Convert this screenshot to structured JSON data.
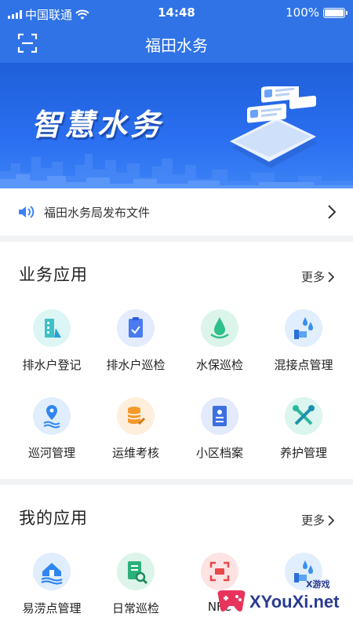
{
  "status_bar": {
    "carrier": "中国联通",
    "time": "14:48",
    "battery": "100%"
  },
  "nav": {
    "title": "福田水务",
    "scan_icon": "scan-icon"
  },
  "banner": {
    "title": "智慧水务"
  },
  "notice": {
    "text": "福田水务局发布文件"
  },
  "business_apps": {
    "title": "业务应用",
    "more": "更多",
    "items": [
      {
        "label": "排水户登记",
        "icon": "building-water-icon",
        "color": "#3fc1c9"
      },
      {
        "label": "排水户巡检",
        "icon": "clipboard-check-icon",
        "color": "#4a7cf0"
      },
      {
        "label": "水保巡检",
        "icon": "water-drop-icon",
        "color": "#2fbf8a"
      },
      {
        "label": "混接点管理",
        "icon": "pipe-drops-icon",
        "color": "#3b8ff0"
      },
      {
        "label": "巡河管理",
        "icon": "location-water-icon",
        "color": "#2f86f0"
      },
      {
        "label": "运维考核",
        "icon": "database-tool-icon",
        "color": "#f39a2b"
      },
      {
        "label": "小区档案",
        "icon": "archive-icon",
        "color": "#3c6fe0"
      },
      {
        "label": "养护管理",
        "icon": "wrench-screwdriver-icon",
        "color": "#2cb89c"
      }
    ]
  },
  "my_apps": {
    "title": "我的应用",
    "more": "更多",
    "items": [
      {
        "label": "易涝点管理",
        "icon": "house-flood-icon",
        "color": "#2f86f0"
      },
      {
        "label": "日常巡检",
        "icon": "document-search-icon",
        "color": "#2cb07a"
      },
      {
        "label": "NFC",
        "icon": "nfc-scan-icon",
        "color": "#e8484a"
      },
      {
        "label": "",
        "icon": "pipe-drops-icon",
        "color": "#3b8ff0"
      }
    ]
  },
  "watermark": {
    "text": "XYouXi.net",
    "small": "X游戏"
  }
}
